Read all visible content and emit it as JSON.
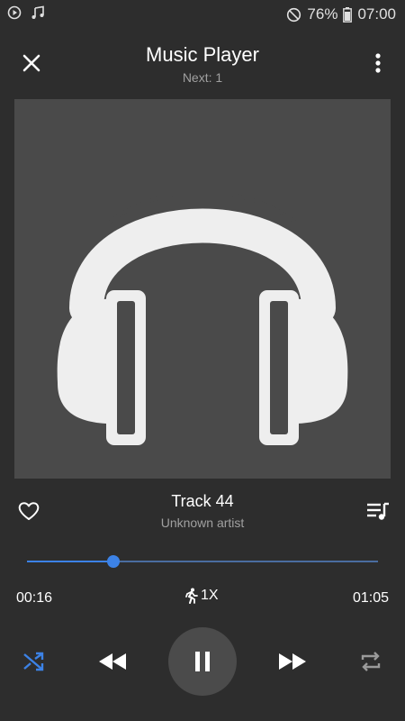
{
  "status_bar": {
    "battery": "76%",
    "time": "07:00",
    "icons": [
      "media-play-icon",
      "music-note-icon",
      "do-not-disturb-icon",
      "battery-icon"
    ]
  },
  "header": {
    "title": "Music Player",
    "subtitle": "Next: 1",
    "icons": [
      "close-icon",
      "more-vert-icon"
    ]
  },
  "album_art": {
    "icon": "headphones-icon"
  },
  "track": {
    "title": "Track 44",
    "artist": "Unknown artist"
  },
  "playback": {
    "current_time": "00:16",
    "total_time": "01:05",
    "progress": 0.246,
    "speed": "1X"
  },
  "controls": {
    "icons": [
      "shuffle-icon",
      "rewind-icon",
      "pause-icon",
      "fast-forward-icon",
      "repeat-icon"
    ],
    "shuffle_active": true
  },
  "colors": {
    "background": "#2d2d2d",
    "art_background": "#4a4a4a",
    "accent": "#3c82e6",
    "secondary_text": "#a0a0a0",
    "icon": "#eeeeee"
  }
}
